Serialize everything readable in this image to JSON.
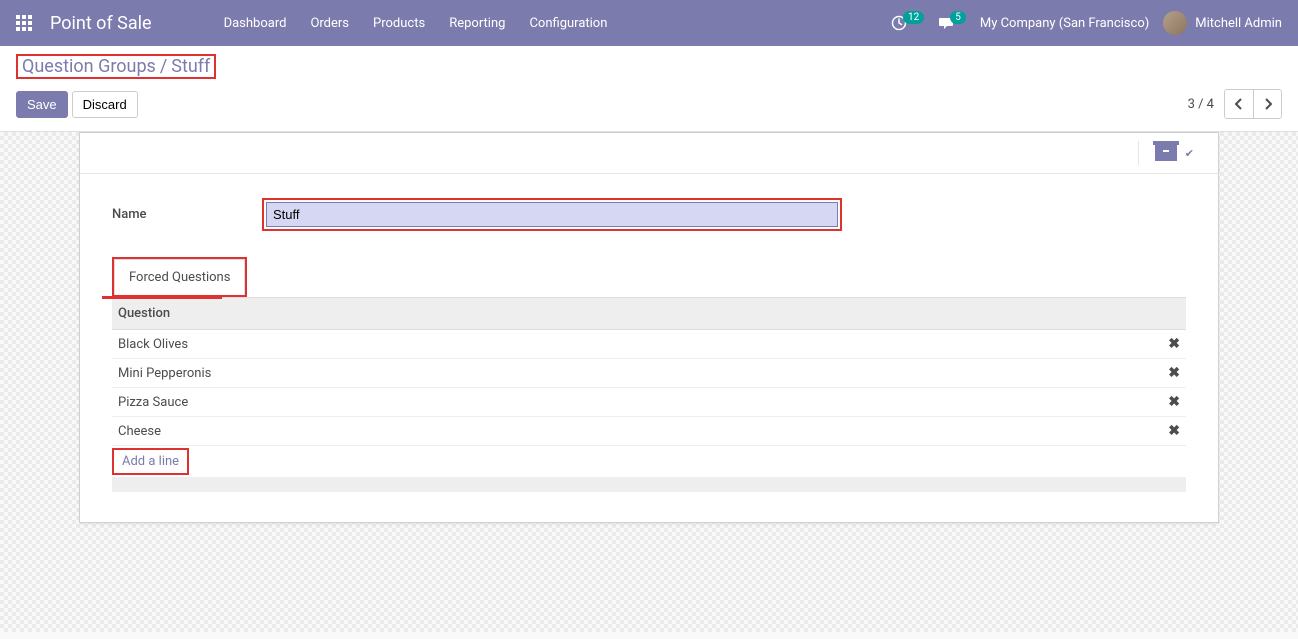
{
  "nav": {
    "brand": "Point of Sale",
    "menu": [
      "Dashboard",
      "Orders",
      "Products",
      "Reporting",
      "Configuration"
    ],
    "clock_badge": "12",
    "chat_badge": "5",
    "company": "My Company (San Francisco)",
    "user": "Mitchell Admin"
  },
  "breadcrumb": {
    "parent": "Question Groups",
    "sep": "/",
    "current": "Stuff"
  },
  "buttons": {
    "save": "Save",
    "discard": "Discard"
  },
  "pager": {
    "info": "3 / 4"
  },
  "form": {
    "name_label": "Name",
    "name_value": "Stuff",
    "tab_label": "Forced Questions",
    "col_header": "Question",
    "rows": [
      "Black Olives",
      "Mini Pepperonis",
      "Pizza Sauce",
      "Cheese"
    ],
    "add_line": "Add a line"
  }
}
